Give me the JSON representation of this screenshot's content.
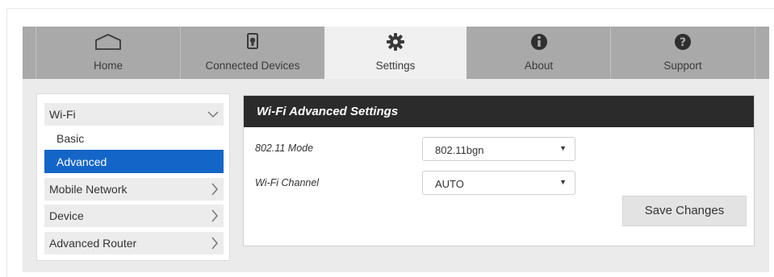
{
  "nav": {
    "tabs": [
      {
        "label": "Home",
        "icon": "home-icon"
      },
      {
        "label": "Connected Devices",
        "icon": "device-icon"
      },
      {
        "label": "Settings",
        "icon": "gear-icon",
        "active": true
      },
      {
        "label": "About",
        "icon": "info-icon"
      },
      {
        "label": "Support",
        "icon": "help-icon"
      }
    ]
  },
  "sidebar": {
    "wifi": {
      "label": "Wi-Fi",
      "icon": "chevron-down-icon"
    },
    "submenu": [
      {
        "label": "Basic"
      },
      {
        "label": "Advanced",
        "active": true
      }
    ],
    "items": [
      {
        "label": "Mobile Network",
        "icon": "chevron-right-icon"
      },
      {
        "label": "Device",
        "icon": "chevron-right-icon"
      },
      {
        "label": "Advanced Router",
        "icon": "chevron-right-icon"
      }
    ]
  },
  "panel": {
    "title": "Wi-Fi Advanced Settings",
    "mode_label": "802.11 Mode",
    "mode_value": "802.11bgn",
    "channel_label": "Wi-Fi Channel",
    "channel_value": "AUTO",
    "save_label": "Save Changes"
  },
  "colors": {
    "nav_bg": "#a9a9a9",
    "nav_active_bg": "#f0f0f0",
    "submenu_active": "#1366c7",
    "panel_header": "#2b2b2b"
  }
}
